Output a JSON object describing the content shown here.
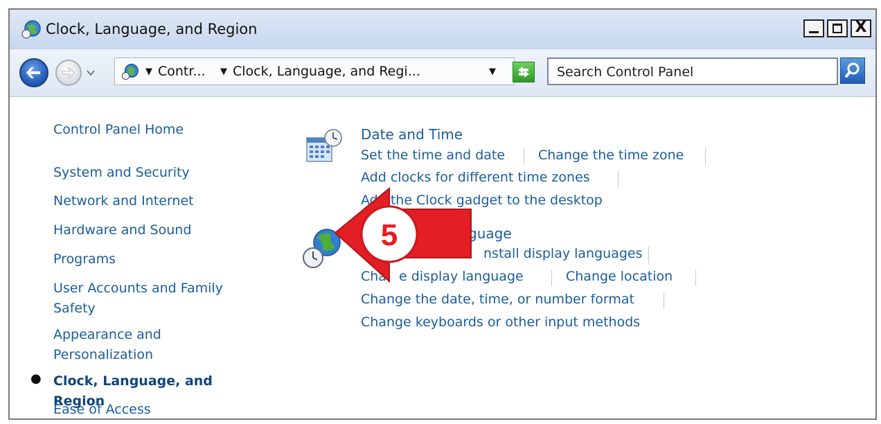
{
  "window": {
    "title": "Clock, Language, and Region",
    "buttons": {
      "minimize": "_",
      "maximize": "□",
      "close": "X"
    }
  },
  "toolbar": {
    "breadcrumbs": [
      "Contr...",
      "Clock, Language, and Regi..."
    ],
    "search_placeholder": "Search Control Panel"
  },
  "sidebar": {
    "items": [
      {
        "label": "Control Panel Home"
      },
      {
        "label": "System and Security"
      },
      {
        "label": "Network and Internet"
      },
      {
        "label": "Hardware and Sound"
      },
      {
        "label": "Programs"
      },
      {
        "label": "User Accounts and Family Safety"
      },
      {
        "label": "Appearance and Personalization"
      },
      {
        "label": "Clock, Language, and Region",
        "current": true
      },
      {
        "label": "Ease of Access"
      }
    ]
  },
  "content": {
    "date_time": {
      "heading": "Date and Time",
      "tasks": [
        "Set the time and date",
        "Change the time zone",
        "Add clocks for different time zones",
        "Add the Clock gadget to the desktop"
      ]
    },
    "region_language": {
      "heading_visible": "guage",
      "tasks_visible": [
        "nstall display languages",
        "Cha",
        "e display language",
        "Change location",
        "Change the date, time, or number format",
        "Change keyboards or other input methods"
      ]
    }
  },
  "callout": {
    "number": "5",
    "color": "#e31e24"
  }
}
